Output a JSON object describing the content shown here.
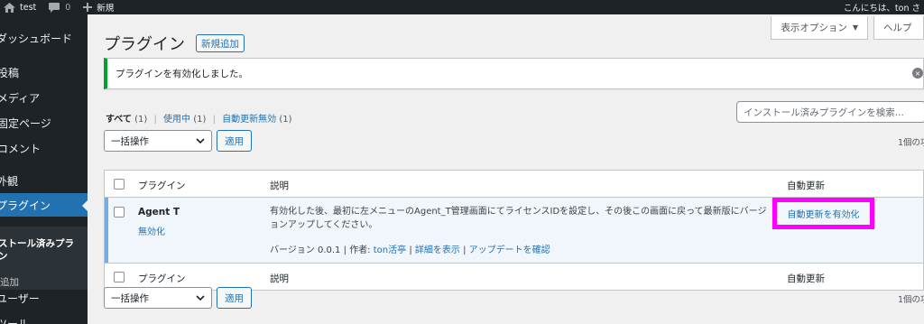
{
  "admin_bar": {
    "icons": [
      "home-icon",
      "comment-icon",
      "plus-icon"
    ],
    "site_name": "test",
    "comments_count": "0",
    "new_label": "新規",
    "greeting": "こんにちは、ton さ"
  },
  "sidebar": {
    "items": [
      {
        "label": "ダッシュボード"
      },
      {
        "label": "投稿"
      },
      {
        "label": "メディア"
      },
      {
        "label": "固定ページ"
      },
      {
        "label": "コメント"
      },
      {
        "label": "外観"
      },
      {
        "label": "プラグイン"
      },
      {
        "label": "ユーザー"
      },
      {
        "label": "ツール"
      }
    ],
    "submenu": {
      "installed": "ストール済みプラ\nン",
      "add_new": "追加"
    }
  },
  "screen_options": {
    "label": "表示オプション",
    "caret": "▼"
  },
  "help_tab": {
    "label": "ヘルプ"
  },
  "page": {
    "title": "プラグイン",
    "add_new": "新規追加"
  },
  "notice": {
    "message": "プラグインを有効化しました。"
  },
  "filters": {
    "all": "すべて",
    "all_count": "(1)",
    "active": "使用中",
    "active_count": "(1)",
    "auto_update_disabled": "自動更新無効",
    "auto_update_disabled_count": "(1)",
    "separator": "|"
  },
  "search": {
    "placeholder": "インストール済みプラグインを検索..."
  },
  "bulk_actions": {
    "label": "一括操作",
    "apply": "適用"
  },
  "item_count": "1個の項",
  "table": {
    "headers": {
      "name": "プラグイン",
      "description": "説明",
      "auto_update": "自動更新"
    },
    "rows": [
      {
        "name": "Agent T",
        "deactivate": "無効化",
        "description": "有効化した後、最初に左メニューのAgent_T管理画面にてライセンスIDを設定し、その後この画面に戻って最新版にバージョンアップしてください。",
        "version": "バージョン 0.0.1",
        "separator": "|",
        "author_label": "作者:",
        "author": "ton活亭",
        "view_details": "詳細を表示",
        "check_updates": "アップデートを確認",
        "enable_auto_update": "自動更新を有効化"
      }
    ]
  },
  "colors": {
    "admin_bg": "#1d2327",
    "accent": "#2271b1",
    "success": "#00a32a",
    "highlight": "#ff00ff"
  }
}
